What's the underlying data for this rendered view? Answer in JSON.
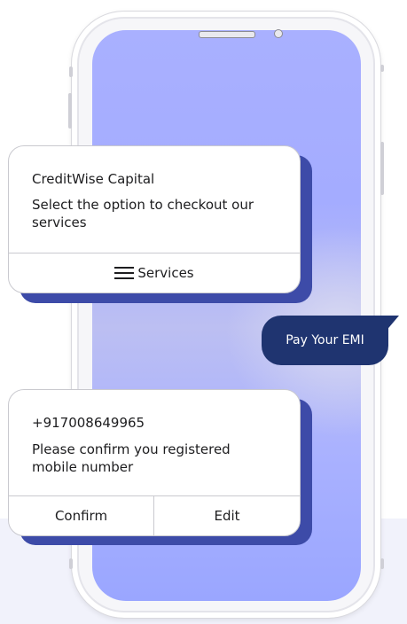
{
  "card1": {
    "title": "CreditWise Capital",
    "message": "Select the option to checkout our services",
    "action_label": "Services",
    "action_icon": "menu-icon"
  },
  "reply": {
    "text": "Pay Your EMI",
    "color": "#1f3470"
  },
  "card2": {
    "title": "+917008649965",
    "message": "Please confirm you registered mobile number",
    "confirm_label": "Confirm",
    "edit_label": "Edit"
  },
  "colors": {
    "screen": "#a9b0ff",
    "card_shadow": "#3d4ba8",
    "card_bg": "#ffffff"
  }
}
